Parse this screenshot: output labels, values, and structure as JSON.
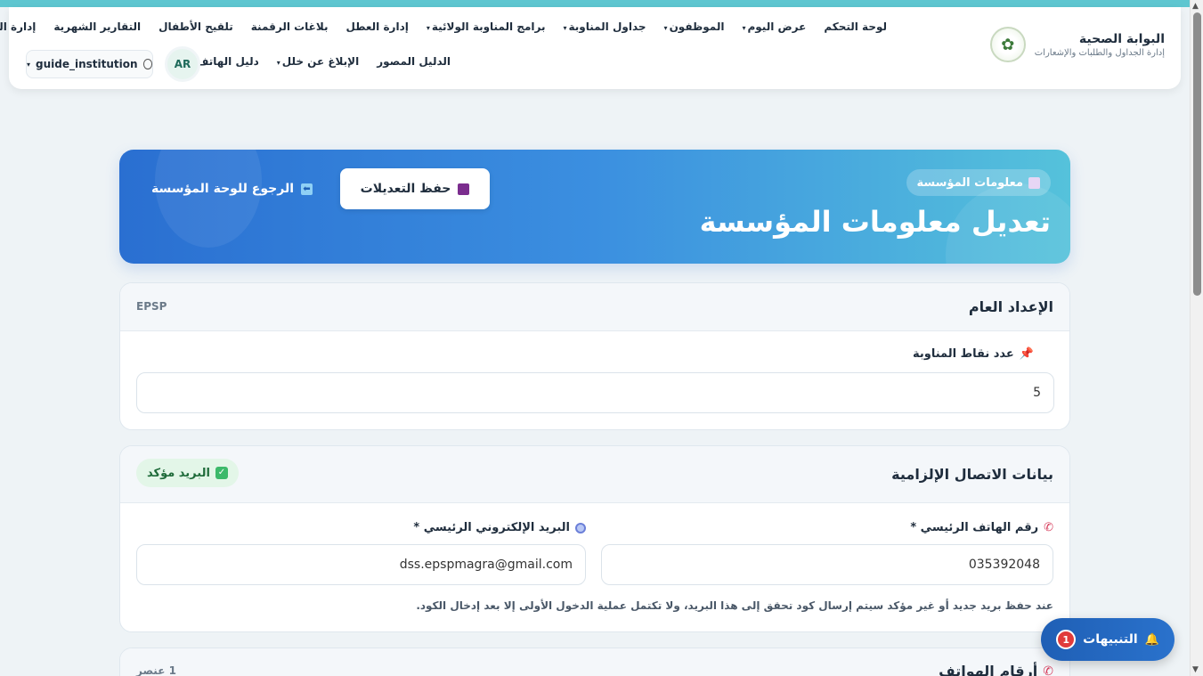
{
  "brand": {
    "title": "البوابة الصحية",
    "subtitle": "إدارة الجداول والطلبات والإشعارات"
  },
  "nav_row1": [
    {
      "label": "لوحة التحكم",
      "dropdown": false
    },
    {
      "label": "عرض اليوم",
      "dropdown": true
    },
    {
      "label": "الموظفون",
      "dropdown": true
    },
    {
      "label": "جداول المناوبة",
      "dropdown": true
    },
    {
      "label": "برامج المناوبة الولائية",
      "dropdown": true
    },
    {
      "label": "إدارة العطل",
      "dropdown": false
    },
    {
      "label": "بلاغات الرقمنة",
      "dropdown": false
    },
    {
      "label": "تلقيح الأطفال",
      "dropdown": false
    },
    {
      "label": "التقارير الشهرية",
      "dropdown": false
    },
    {
      "label": "إدارة التبديلات",
      "dropdown": false
    }
  ],
  "nav_row2": [
    {
      "label": "الدليل المصور",
      "dropdown": false
    },
    {
      "label": "الإبلاغ عن خلل",
      "dropdown": true
    },
    {
      "label": "دليل الهاتف",
      "dropdown": false
    }
  ],
  "user": {
    "avatar": "AR",
    "username": "guide_institution"
  },
  "hero": {
    "pill": "معلومات المؤسسة",
    "title": "تعديل معلومات المؤسسة",
    "save_label": "حفظ التعديلات",
    "back_label": "الرجوع للوحة المؤسسة"
  },
  "general": {
    "title": "الإعداد العام",
    "tag": "EPSP",
    "points_label": "عدد نقاط المناوبة",
    "points_value": "5"
  },
  "contact": {
    "title": "بيانات الاتصال الإلزامية",
    "badge": "البريد مؤكد",
    "phone_label": "رقم الهاتف الرئيسي *",
    "phone_value": "035392048",
    "email_label": "البريد الإلكتروني الرئيسي *",
    "email_value": "dss.epspmagra@gmail.com",
    "hint": "عند حفظ بريد جديد أو غير مؤكد سيتم إرسال كود تحقق إلى هذا البريد، ولا تكتمل عملية الدخول الأولى إلا بعد إدخال الكود."
  },
  "phones": {
    "title": "أرقام الهواتف",
    "count": "1 عنصر"
  },
  "notifications": {
    "label": "التنبيهات",
    "count": "1"
  },
  "colors": {
    "accent": "#2a6fd1",
    "teal": "#5ec6d0",
    "success": "#3cb96a",
    "danger": "#e03b3b"
  }
}
